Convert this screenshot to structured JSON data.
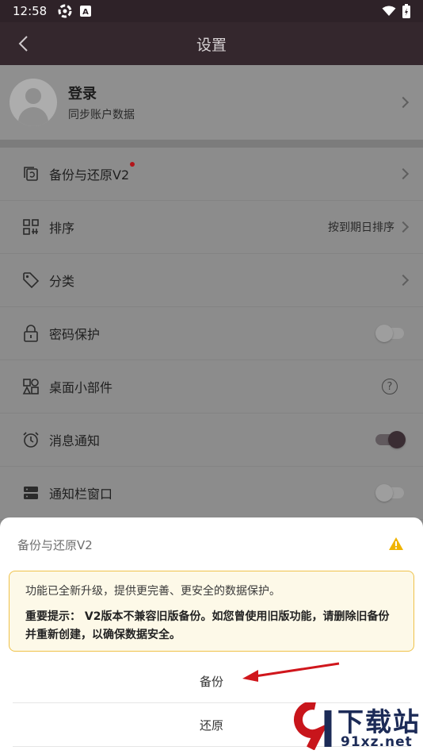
{
  "status_bar": {
    "time": "12:58",
    "notification_icons": [
      "settings-app-icon",
      "a-app-icon"
    ],
    "right_icons": [
      "wifi-icon",
      "battery-charging-icon"
    ]
  },
  "app_bar": {
    "title": "设置"
  },
  "login": {
    "title": "登录",
    "subtitle": "同步账户数据"
  },
  "settings": {
    "items": [
      {
        "label": "备份与还原V2",
        "icon": "backup-restore-icon",
        "control": "chevron",
        "badge_dot": true
      },
      {
        "label": "排序",
        "icon": "sort-grid-icon",
        "control": "chevron",
        "value": "按到期日排序"
      },
      {
        "label": "分类",
        "icon": "tag-icon",
        "control": "chevron"
      },
      {
        "label": "密码保护",
        "icon": "lock-icon",
        "control": "toggle",
        "on": false
      },
      {
        "label": "桌面小部件",
        "icon": "widgets-icon",
        "control": "help"
      },
      {
        "label": "消息通知",
        "icon": "alarm-clock-icon",
        "control": "toggle",
        "on": true
      },
      {
        "label": "通知栏窗口",
        "icon": "notification-panel-icon",
        "control": "toggle",
        "on": false
      }
    ]
  },
  "sheet": {
    "title": "备份与还原V2",
    "notice_line1": "功能已全新升级，提供更完善、更安全的数据保护。",
    "notice_line2": "重要提示： V2版本不兼容旧版备份。如您曾使用旧版功能，请删除旧备份并重新创建，以确保数据安全。",
    "actions": {
      "backup": "备份",
      "restore": "还原"
    }
  },
  "watermark": {
    "brand": "下载站",
    "domain": "91xz.net"
  },
  "colors": {
    "app_bar": "#34272d",
    "status_bar": "#2e2228",
    "accent_dark": "#3a2d33",
    "warning": "#efc24a",
    "notice_bg": "#fdf9e8",
    "badge_red": "#b3151a",
    "arrow_red": "#d0161c"
  }
}
